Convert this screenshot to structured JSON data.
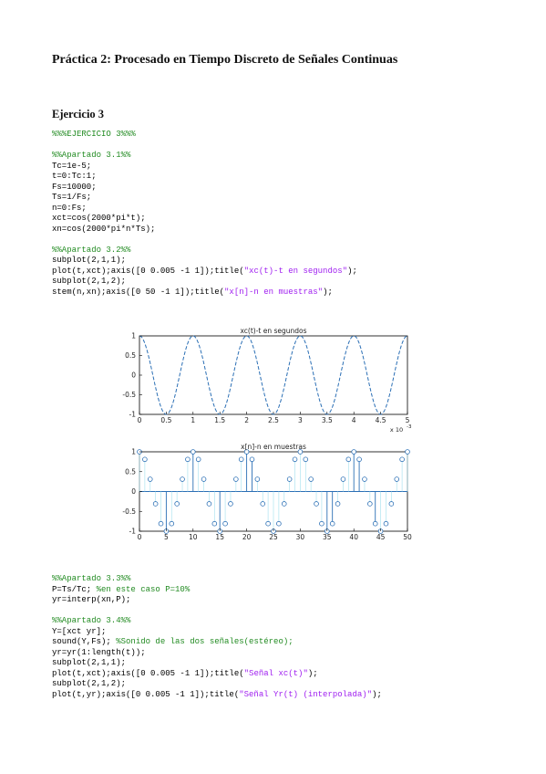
{
  "doc_title": "Práctica 2: Procesado en Tiempo Discreto de Señales Continuas",
  "section_title": "Ejercicio 3",
  "code_block_1": [
    [
      {
        "t": "%%%EJERCICIO 3%%%",
        "c": "cm"
      }
    ],
    null,
    [
      {
        "t": "%%Apartado 3.1%%",
        "c": "cm"
      }
    ],
    [
      {
        "t": "Tc=1e-5;"
      }
    ],
    [
      {
        "t": "t=0:Tc:1;"
      }
    ],
    [
      {
        "t": "Fs=10000;"
      }
    ],
    [
      {
        "t": "Ts=1/Fs;"
      }
    ],
    [
      {
        "t": "n=0:Fs;"
      }
    ],
    [
      {
        "t": "xct=cos(2000*pi*t);"
      }
    ],
    [
      {
        "t": "xn=cos(2000*pi*n*Ts);"
      }
    ],
    null,
    [
      {
        "t": "%%Apartado 3.2%%",
        "c": "cm"
      }
    ],
    [
      {
        "t": "subplot(2,1,1);"
      }
    ],
    [
      {
        "t": "plot(t,xct);axis([0 0.005 -1 1]);title("
      },
      {
        "t": "\"xc(t)-t en segundos\"",
        "c": "st"
      },
      {
        "t": ");"
      }
    ],
    [
      {
        "t": "subplot(2,1,2);"
      }
    ],
    [
      {
        "t": "stem(n,xn);axis([0 50 -1 1]);title("
      },
      {
        "t": "\"x[n]-n en muestras\"",
        "c": "st"
      },
      {
        "t": ");"
      }
    ]
  ],
  "code_block_2": [
    [
      {
        "t": "%%Apartado 3.3%%",
        "c": "cm"
      }
    ],
    [
      {
        "t": "P=Ts/Tc; "
      },
      {
        "t": "%en este caso P=10%",
        "c": "cm"
      }
    ],
    [
      {
        "t": "yr=interp(xn,P);"
      }
    ],
    null,
    [
      {
        "t": "%%Apartado 3.4%%",
        "c": "cm"
      }
    ],
    [
      {
        "t": "Y=[xct yr];"
      }
    ],
    [
      {
        "t": "sound(Y,Fs); "
      },
      {
        "t": "%Sonido de las dos señales(estéreo);",
        "c": "cm"
      }
    ],
    [
      {
        "t": "yr=yr(1:length(t));"
      }
    ],
    [
      {
        "t": "subplot(2,1,1);"
      }
    ],
    [
      {
        "t": "plot(t,xct);axis([0 0.005 -1 1]);title("
      },
      {
        "t": "\"Señal xc(t)\"",
        "c": "st"
      },
      {
        "t": ");"
      }
    ],
    [
      {
        "t": "subplot(2,1,2);"
      }
    ],
    [
      {
        "t": "plot(t,yr);axis([0 0.005 -1 1]);title("
      },
      {
        "t": "\"Señal Yr(t) (interpolada)\"",
        "c": "st"
      },
      {
        "t": ");"
      }
    ]
  ],
  "colors": {
    "line": "#2b6fb5",
    "stem": "#2b6fb5",
    "faint_stem": "#aee4f0",
    "comment": "#228b22",
    "string": "#a020f0"
  },
  "chart_data": [
    {
      "type": "line",
      "title": "xc(t)-t en segundos",
      "function": "cos(2000*pi*t)",
      "xlim": [
        0,
        0.005
      ],
      "ylim": [
        -1,
        1
      ],
      "x_tick_labels": [
        "0",
        "0.5",
        "1",
        "1.5",
        "2",
        "2.5",
        "3",
        "3.5",
        "4",
        "4.5",
        "5"
      ],
      "x_tick_values": [
        0,
        0.0005,
        0.001,
        0.0015,
        0.002,
        0.0025,
        0.003,
        0.0035,
        0.004,
        0.0045,
        0.005
      ],
      "x_exponent_label": "x 10",
      "x_exponent": "-3",
      "y_tick_labels": [
        "1",
        "0.5",
        "0",
        "-0.5",
        "-1"
      ],
      "y_tick_values": [
        1,
        0.5,
        0,
        -0.5,
        -1
      ],
      "line_style": "dashed"
    },
    {
      "type": "stem",
      "title": "x[n]-n en muestras",
      "xlim": [
        0,
        50
      ],
      "ylim": [
        -1,
        1
      ],
      "x_tick_labels": [
        "0",
        "5",
        "10",
        "15",
        "20",
        "25",
        "30",
        "35",
        "40",
        "45",
        "50"
      ],
      "x_tick_values": [
        0,
        5,
        10,
        15,
        20,
        25,
        30,
        35,
        40,
        45,
        50
      ],
      "y_tick_labels": [
        "1",
        "0.5",
        "0",
        "-0.5",
        "-1"
      ],
      "y_tick_values": [
        1,
        0.5,
        0,
        -0.5,
        -1
      ],
      "n": [
        0,
        1,
        2,
        3,
        4,
        5,
        6,
        7,
        8,
        9,
        10,
        11,
        12,
        13,
        14,
        15,
        16,
        17,
        18,
        19,
        20,
        21,
        22,
        23,
        24,
        25,
        26,
        27,
        28,
        29,
        30,
        31,
        32,
        33,
        34,
        35,
        36,
        37,
        38,
        39,
        40,
        41,
        42,
        43,
        44,
        45,
        46,
        47,
        48,
        49,
        50
      ],
      "values": [
        1,
        0.809,
        0.309,
        -0.309,
        -0.809,
        -1,
        -0.809,
        -0.309,
        0.309,
        0.809,
        1,
        0.809,
        0.309,
        -0.309,
        -0.809,
        -1,
        -0.809,
        -0.309,
        0.309,
        0.809,
        1,
        0.809,
        0.309,
        -0.309,
        -0.809,
        -1,
        -0.809,
        -0.309,
        0.309,
        0.809,
        1,
        0.809,
        0.309,
        -0.309,
        -0.809,
        -1,
        -0.809,
        -0.309,
        0.309,
        0.809,
        1,
        0.809,
        0.309,
        -0.309,
        -0.809,
        -1,
        -0.809,
        -0.309,
        0.309,
        0.809,
        1
      ],
      "bold_stems_n": [
        5,
        10,
        15,
        20,
        21,
        35,
        36,
        40,
        41,
        44
      ]
    }
  ]
}
